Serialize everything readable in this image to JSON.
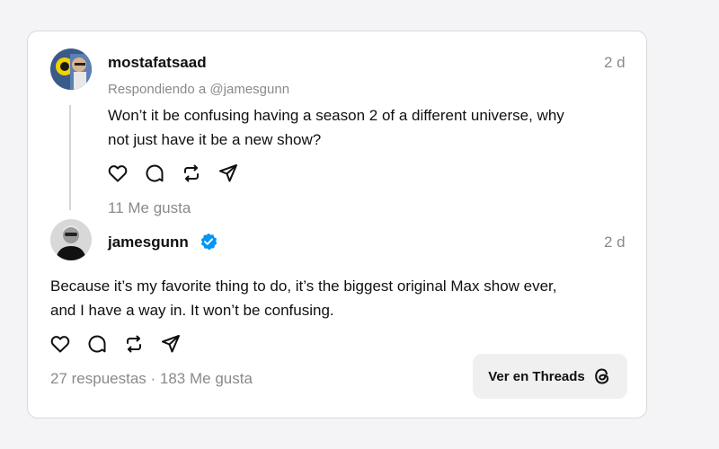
{
  "first_post": {
    "username": "mostafatsaad",
    "time": "2 d",
    "replying_to": "Respondiendo a @jamesgunn",
    "text_line1": "Won’t it be confusing having a season 2 of a different universe, why",
    "text_line2": "not just have it be a new show?",
    "likes": "11 Me gusta"
  },
  "second_post": {
    "username": "jamesgunn",
    "time": "2 d",
    "text_line1": "Because it’s my favorite thing to do, it’s the biggest original Max show ever,",
    "text_line2": "and I have a way in. It won’t be confusing.",
    "stats": "27 respuestas · 183 Me gusta"
  },
  "view_button": {
    "label": "Ver en Threads"
  },
  "colors": {
    "verified_blue": "#0095f6",
    "muted_text": "#8a8a8a"
  },
  "icons": [
    "heart-icon",
    "comment-icon",
    "repost-icon",
    "share-icon",
    "verified-icon",
    "threads-logo-icon"
  ]
}
